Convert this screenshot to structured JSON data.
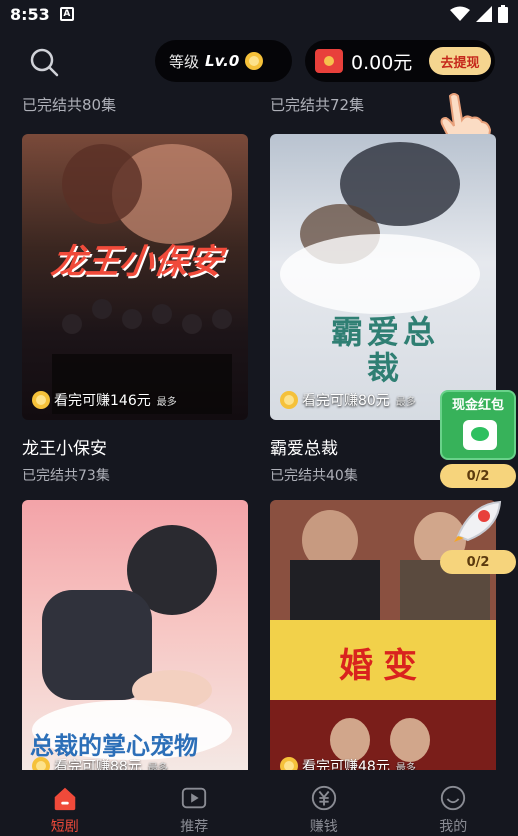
{
  "status_bar": {
    "time": "8:53",
    "app_indicator": "A"
  },
  "header": {
    "level_label": "等级",
    "level_value": "Lv.0",
    "balance": "0.00元",
    "withdraw_label": "去提现"
  },
  "previous_row": [
    {
      "subtitle": "已完结共80集"
    },
    {
      "subtitle": "已完结共72集"
    }
  ],
  "dramas": [
    {
      "title": "龙王小保安",
      "subtitle": "已完结共73集",
      "earn_text": "看完可赚146元",
      "earn_tag": "最多",
      "poster_text": "龙王小保安"
    },
    {
      "title": "霸爱总裁",
      "subtitle": "已完结共40集",
      "earn_text": "看完可赚80元",
      "earn_tag": "最多",
      "poster_text": "霸爱总裁"
    },
    {
      "title": "",
      "subtitle": "",
      "earn_text": "看完可赚88元",
      "earn_tag": "最多",
      "poster_text": "总裁的掌心宠物"
    },
    {
      "title": "",
      "subtitle": "",
      "earn_text": "看完可赚48元",
      "earn_tag": "最多",
      "poster_text": "婚变"
    }
  ],
  "floating_cash": {
    "label": "现金红包",
    "progress": "0/2"
  },
  "floating_rocket": {
    "progress": "0/2"
  },
  "tabbar": {
    "items": [
      {
        "label": "短剧",
        "icon": "home-icon",
        "active": true
      },
      {
        "label": "推荐",
        "icon": "play-icon",
        "active": false
      },
      {
        "label": "赚钱",
        "icon": "yuan-icon",
        "active": false
      },
      {
        "label": "我的",
        "icon": "smile-icon",
        "active": false
      }
    ]
  },
  "colors": {
    "accent": "#f04a3a",
    "background": "#15171f",
    "gold": "#f5d58f"
  }
}
